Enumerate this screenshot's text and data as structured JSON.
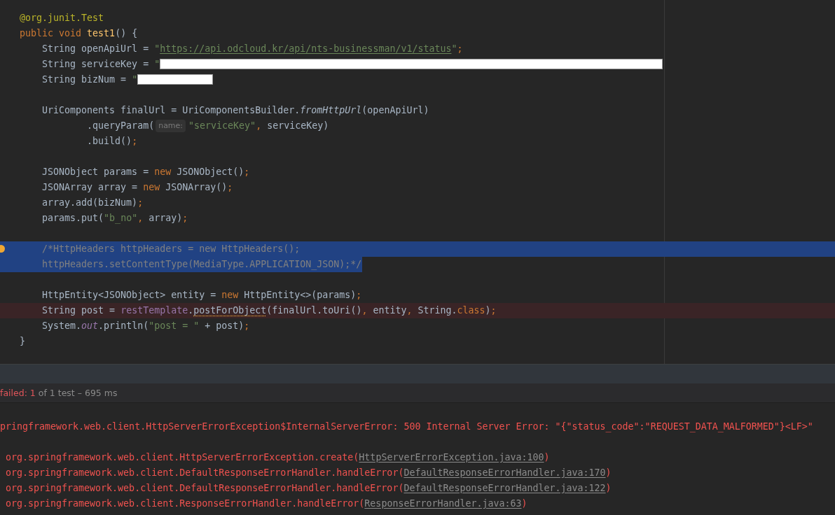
{
  "editor": {
    "lines": [
      {
        "selected": false,
        "error": false,
        "tokens": [
          {
            "kind": "annotation",
            "text": "@org.junit."
          },
          {
            "kind": "annotation_name",
            "text": "Test"
          }
        ]
      },
      {
        "selected": false,
        "error": false,
        "tokens": [
          {
            "kind": "keyword",
            "text": "public void "
          },
          {
            "kind": "method",
            "text": "test1"
          },
          {
            "kind": "plain",
            "text": "() {"
          }
        ]
      },
      {
        "selected": false,
        "error": false,
        "tokens": [
          {
            "kind": "plain",
            "text": "    String openApiUrl = "
          },
          {
            "kind": "string",
            "text": "\""
          },
          {
            "kind": "url",
            "text": "https://api.odcloud.kr/api/nts-businessman/v1/status"
          },
          {
            "kind": "string",
            "text": "\""
          },
          {
            "kind": "keyword",
            "text": ";"
          }
        ]
      },
      {
        "selected": false,
        "error": false,
        "tokens": [
          {
            "kind": "plain",
            "text": "    String serviceKey = "
          },
          {
            "kind": "string",
            "text": "\""
          },
          {
            "kind": "redacted_long"
          }
        ]
      },
      {
        "selected": false,
        "error": false,
        "tokens": [
          {
            "kind": "plain",
            "text": "    String bizNum = "
          },
          {
            "kind": "string",
            "text": "\""
          },
          {
            "kind": "redacted_short"
          }
        ]
      },
      {
        "kind": "blank"
      },
      {
        "selected": false,
        "error": false,
        "tokens": [
          {
            "kind": "plain",
            "text": "    UriComponents finalUrl = UriComponentsBuilder."
          },
          {
            "kind": "static",
            "text": "fromHttpUrl"
          },
          {
            "kind": "plain",
            "text": "(openApiUrl)"
          }
        ]
      },
      {
        "selected": false,
        "error": false,
        "tokens": [
          {
            "kind": "plain",
            "text": "            .queryParam("
          },
          {
            "kind": "hint",
            "text": "name:"
          },
          {
            "kind": "string",
            "text": "\"serviceKey\""
          },
          {
            "kind": "keyword",
            "text": ", "
          },
          {
            "kind": "plain",
            "text": "serviceKey)"
          }
        ]
      },
      {
        "selected": false,
        "error": false,
        "tokens": [
          {
            "kind": "plain",
            "text": "            .build()"
          },
          {
            "kind": "keyword",
            "text": ";"
          }
        ]
      },
      {
        "kind": "blank"
      },
      {
        "selected": false,
        "error": false,
        "tokens": [
          {
            "kind": "plain",
            "text": "    JSONObject params = "
          },
          {
            "kind": "keyword",
            "text": "new "
          },
          {
            "kind": "plain",
            "text": "JSONObject()"
          },
          {
            "kind": "keyword",
            "text": ";"
          }
        ]
      },
      {
        "selected": false,
        "error": false,
        "tokens": [
          {
            "kind": "plain",
            "text": "    JSONArray array = "
          },
          {
            "kind": "keyword",
            "text": "new "
          },
          {
            "kind": "plain",
            "text": "JSONArray()"
          },
          {
            "kind": "keyword",
            "text": ";"
          }
        ]
      },
      {
        "selected": false,
        "error": false,
        "tokens": [
          {
            "kind": "plain",
            "text": "    array.add(bizNum)"
          },
          {
            "kind": "keyword",
            "text": ";"
          }
        ]
      },
      {
        "selected": false,
        "error": false,
        "tokens": [
          {
            "kind": "plain",
            "text": "    params.put("
          },
          {
            "kind": "string",
            "text": "\"b_no\""
          },
          {
            "kind": "keyword",
            "text": ", "
          },
          {
            "kind": "plain",
            "text": "array)"
          },
          {
            "kind": "keyword",
            "text": ";"
          }
        ]
      },
      {
        "kind": "blank"
      },
      {
        "selected": true,
        "error": false,
        "bulb": true,
        "tokens": [
          {
            "kind": "comment",
            "text": "    /*HttpHeaders httpHeaders = new HttpHeaders();"
          }
        ]
      },
      {
        "selected": true,
        "error": false,
        "tokens": [
          {
            "kind": "comment",
            "text": "    httpHeaders.setContentType(MediaType.APPLICATION_JSON);*/"
          }
        ]
      },
      {
        "kind": "blank"
      },
      {
        "selected": false,
        "error": false,
        "tokens": [
          {
            "kind": "plain",
            "text": "    HttpEntity<JSONObject> entity = "
          },
          {
            "kind": "keyword",
            "text": "new "
          },
          {
            "kind": "plain",
            "text": "HttpEntity<>(params)"
          },
          {
            "kind": "keyword",
            "text": ";"
          }
        ]
      },
      {
        "selected": false,
        "error": true,
        "tokens": [
          {
            "kind": "plain",
            "text": "    String post = "
          },
          {
            "kind": "field",
            "text": "restTemplate"
          },
          {
            "kind": "plain",
            "text": "."
          },
          {
            "kind": "warning",
            "text": "postForObject"
          },
          {
            "kind": "plain",
            "text": "(finalUrl.toUri()"
          },
          {
            "kind": "keyword",
            "text": ", "
          },
          {
            "kind": "plain",
            "text": "entity"
          },
          {
            "kind": "keyword",
            "text": ", "
          },
          {
            "kind": "plain",
            "text": "String."
          },
          {
            "kind": "keyword",
            "text": "class"
          },
          {
            "kind": "plain",
            "text": ")"
          },
          {
            "kind": "keyword",
            "text": ";"
          }
        ]
      },
      {
        "selected": false,
        "error": false,
        "tokens": [
          {
            "kind": "plain",
            "text": "    System."
          },
          {
            "kind": "static_field",
            "text": "out"
          },
          {
            "kind": "plain",
            "text": ".println("
          },
          {
            "kind": "string",
            "text": "\"post = \""
          },
          {
            "kind": "plain",
            "text": " + post)"
          },
          {
            "kind": "keyword",
            "text": ";"
          }
        ]
      },
      {
        "selected": false,
        "error": false,
        "tokens": [
          {
            "kind": "plain",
            "text": "}"
          }
        ]
      }
    ]
  },
  "test_status": {
    "failed_label": "failed: 1",
    "summary": "of 1 test – 695 ms"
  },
  "console": {
    "lines": [
      {
        "tokens": [
          {
            "kind": "error",
            "text": "pringframework.web.client.HttpServerErrorException$InternalServerError: 500 Internal Server Error: \"{\"status_code\":\"REQUEST_DATA_MALFORMED\"}<LF>\""
          }
        ]
      },
      {
        "kind": "blank"
      },
      {
        "tokens": [
          {
            "kind": "error",
            "text": " org.springframework.web.client.HttpServerErrorException.create("
          },
          {
            "kind": "link",
            "text": "HttpServerErrorException.java:100"
          },
          {
            "kind": "error",
            "text": ")"
          }
        ]
      },
      {
        "tokens": [
          {
            "kind": "error",
            "text": " org.springframework.web.client.DefaultResponseErrorHandler.handleError("
          },
          {
            "kind": "link",
            "text": "DefaultResponseErrorHandler.java:170"
          },
          {
            "kind": "error",
            "text": ")"
          }
        ]
      },
      {
        "tokens": [
          {
            "kind": "error",
            "text": " org.springframework.web.client.DefaultResponseErrorHandler.handleError("
          },
          {
            "kind": "link",
            "text": "DefaultResponseErrorHandler.java:122"
          },
          {
            "kind": "error",
            "text": ")"
          }
        ]
      },
      {
        "tokens": [
          {
            "kind": "error",
            "text": " org.springframework.web.client.ResponseErrorHandler.handleError("
          },
          {
            "kind": "link",
            "text": "ResponseErrorHandler.java:63"
          },
          {
            "kind": "error",
            "text": ")"
          }
        ]
      }
    ]
  }
}
